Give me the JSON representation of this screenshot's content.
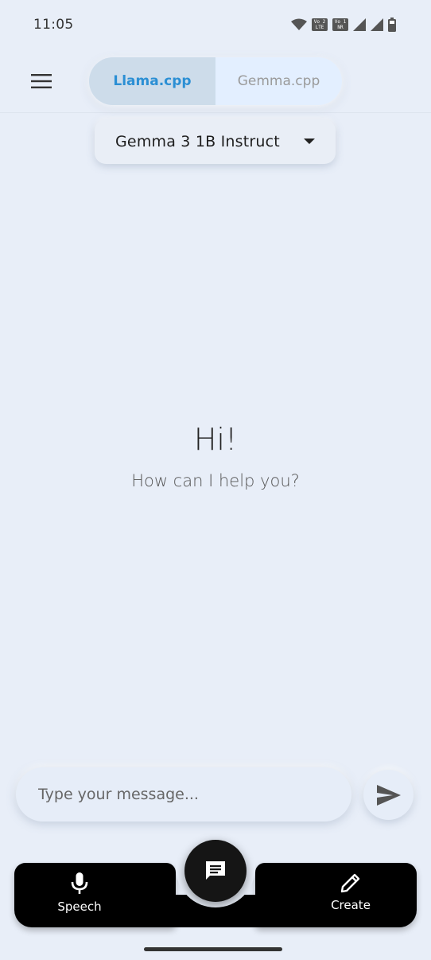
{
  "status_bar": {
    "time": "11:05",
    "badge_1": "Vo 2\nLTE",
    "badge_2": "Vo 1\nNR",
    "icons": [
      "wifi-icon",
      "signal-icon",
      "signal-icon",
      "battery-icon"
    ]
  },
  "header": {
    "menu_icon": "menu-icon",
    "tabs": [
      {
        "label": "Llama.cpp",
        "active": true
      },
      {
        "label": "Gemma.cpp",
        "active": false
      }
    ]
  },
  "model_selector": {
    "selected": "Gemma 3 1B Instruct",
    "icon": "dropdown-arrow-icon"
  },
  "greeting": {
    "title": "Hi!",
    "subtitle": "How can I help you?"
  },
  "composer": {
    "placeholder": "Type your message...",
    "value": "",
    "send_icon": "send-icon"
  },
  "bottom_nav": {
    "left": {
      "label": "Speech",
      "icon": "mic-icon"
    },
    "center": {
      "icon": "chat-icon"
    },
    "right": {
      "label": "Create",
      "icon": "pencil-icon"
    }
  },
  "colors": {
    "background": "#e8eef8",
    "accent": "#2b8fd4",
    "nav": "#000000"
  }
}
